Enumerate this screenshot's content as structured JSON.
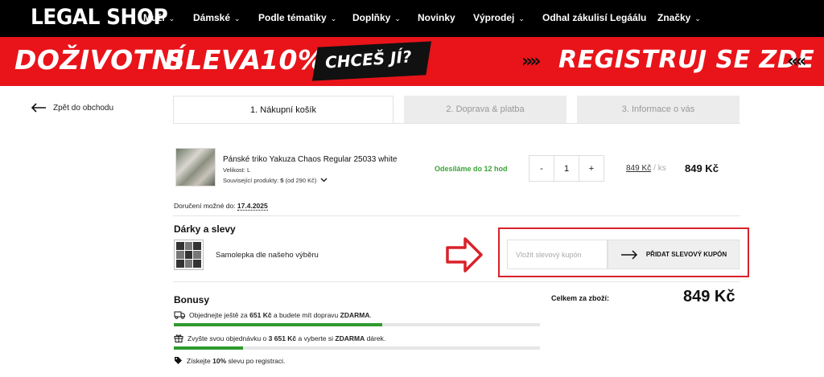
{
  "brand": {
    "logo": "LEGAL SHOP"
  },
  "nav": [
    {
      "label": "Muži",
      "dropdown": true
    },
    {
      "label": "Dámské",
      "dropdown": true
    },
    {
      "label": "Podle tématiky",
      "dropdown": true
    },
    {
      "label": "Doplňky",
      "dropdown": true
    },
    {
      "label": "Novinky",
      "dropdown": false
    },
    {
      "label": "Výprodej",
      "dropdown": true
    },
    {
      "label": "Odhal zákulisí Legáálu",
      "dropdown": false
    },
    {
      "label": "Značky",
      "dropdown": true
    }
  ],
  "banner": {
    "left_a": "DOŽIVOTNÍ",
    "left_b": "SLEVA",
    "left_c": "10%",
    "badge": "CHCEŠ JÍ?",
    "right": "REGISTRUJ SE ZDE",
    "colors": {
      "background": "#e8141a",
      "badge": "#111111"
    }
  },
  "back": {
    "label": "Zpět do obchodu",
    "icon": "arrow-left-icon"
  },
  "steps": [
    {
      "label": "1. Nákupní košík",
      "active": true
    },
    {
      "label": "2. Doprava & platba",
      "active": false
    },
    {
      "label": "3. Informace o vás",
      "active": false
    }
  ],
  "product": {
    "name": "Pánské triko Yakuza Chaos Regular 25033 white",
    "size_label": "Velikost:",
    "size": "L",
    "related_label": "Související produkty:",
    "related_count": "5",
    "related_from": "(od 290 Kč)",
    "shipping": "Odesíláme do 12 hod",
    "qty_minus": "-",
    "qty": "1",
    "qty_plus": "+",
    "unit_price": "849 Kč",
    "unit_suffix": "/ ks",
    "line_total": "849 Kč"
  },
  "delivery": {
    "label": "Doručení možné do:",
    "date": "17.4.2025"
  },
  "gifts": {
    "title": "Dárky a slevy",
    "item": "Samolepka dle našeho výběru"
  },
  "coupon": {
    "placeholder": "Vložit slevový kupón",
    "button": "PŘIDAT SLEVOVÝ KUPÓN",
    "highlight_color": "#d9212a"
  },
  "bonus": {
    "title": "Bonusy",
    "items": [
      {
        "icon": "truck-icon",
        "pre": "Objednejte ještě za",
        "amount": "651 Kč",
        "mid": "a budete mít dopravu",
        "bold": "ZDARMA",
        "post": ".",
        "progress": 0.57
      },
      {
        "icon": "gift-icon",
        "pre": "Zvyšte svou objednávku o",
        "amount": "3 651 Kč",
        "mid": "a vyberte si",
        "bold": "ZDARMA",
        "post": "dárek.",
        "progress": 0.19
      },
      {
        "icon": "tag-icon",
        "pre": "Získejte",
        "amount": "10%",
        "mid": "slevu po registraci.",
        "bold": "",
        "post": ""
      }
    ],
    "progress_color": "#2e9a2e"
  },
  "summary": {
    "label": "Celkem za zboží:",
    "value": "849 Kč"
  }
}
